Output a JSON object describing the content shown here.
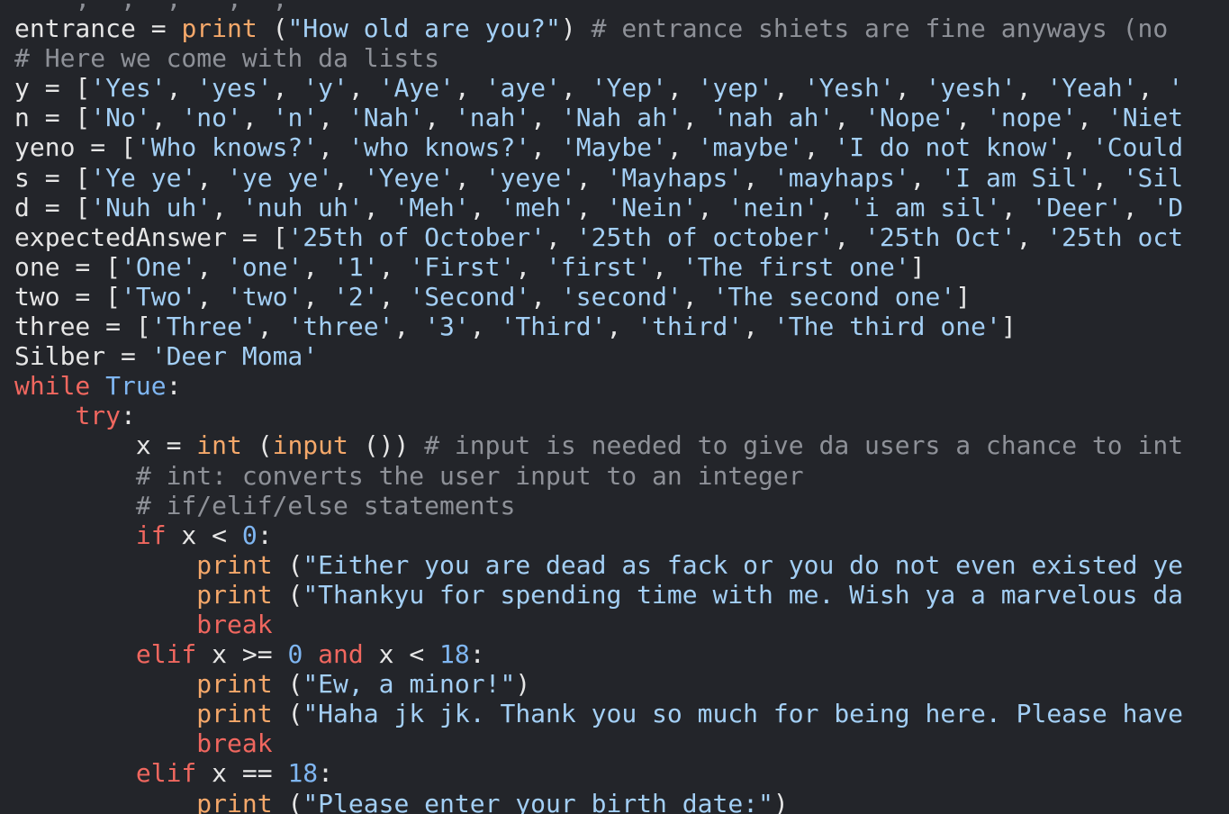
{
  "theme": {
    "background": "#23252a",
    "default": "#e6e6e6",
    "keyword": "#f0675f",
    "builtin": "#f5a86a",
    "string": "#a3cff5",
    "number": "#7fb6f2",
    "comment": "#8e9198"
  },
  "lines": [
    [
      [
        "comment",
        "    ,  ,  ,   ,  ,"
      ]
    ],
    [
      [
        "default",
        "entrance = "
      ],
      [
        "builtin",
        "print"
      ],
      [
        "default",
        " ("
      ],
      [
        "string",
        "\"How old are you?\""
      ],
      [
        "default",
        ") "
      ],
      [
        "comment",
        "# entrance shiets are fine anyways (no"
      ]
    ],
    [
      [
        "comment",
        "# Here we come with da lists"
      ]
    ],
    [
      [
        "default",
        "y = ["
      ],
      [
        "string",
        "'Yes'"
      ],
      [
        "default",
        ", "
      ],
      [
        "string",
        "'yes'"
      ],
      [
        "default",
        ", "
      ],
      [
        "string",
        "'y'"
      ],
      [
        "default",
        ", "
      ],
      [
        "string",
        "'Aye'"
      ],
      [
        "default",
        ", "
      ],
      [
        "string",
        "'aye'"
      ],
      [
        "default",
        ", "
      ],
      [
        "string",
        "'Yep'"
      ],
      [
        "default",
        ", "
      ],
      [
        "string",
        "'yep'"
      ],
      [
        "default",
        ", "
      ],
      [
        "string",
        "'Yesh'"
      ],
      [
        "default",
        ", "
      ],
      [
        "string",
        "'yesh'"
      ],
      [
        "default",
        ", "
      ],
      [
        "string",
        "'Yeah'"
      ],
      [
        "default",
        ", "
      ],
      [
        "string",
        "'"
      ]
    ],
    [
      [
        "default",
        "n = ["
      ],
      [
        "string",
        "'No'"
      ],
      [
        "default",
        ", "
      ],
      [
        "string",
        "'no'"
      ],
      [
        "default",
        ", "
      ],
      [
        "string",
        "'n'"
      ],
      [
        "default",
        ", "
      ],
      [
        "string",
        "'Nah'"
      ],
      [
        "default",
        ", "
      ],
      [
        "string",
        "'nah'"
      ],
      [
        "default",
        ", "
      ],
      [
        "string",
        "'Nah ah'"
      ],
      [
        "default",
        ", "
      ],
      [
        "string",
        "'nah ah'"
      ],
      [
        "default",
        ", "
      ],
      [
        "string",
        "'Nope'"
      ],
      [
        "default",
        ", "
      ],
      [
        "string",
        "'nope'"
      ],
      [
        "default",
        ", "
      ],
      [
        "string",
        "'Niet"
      ]
    ],
    [
      [
        "default",
        "yeno = ["
      ],
      [
        "string",
        "'Who knows?'"
      ],
      [
        "default",
        ", "
      ],
      [
        "string",
        "'who knows?'"
      ],
      [
        "default",
        ", "
      ],
      [
        "string",
        "'Maybe'"
      ],
      [
        "default",
        ", "
      ],
      [
        "string",
        "'maybe'"
      ],
      [
        "default",
        ", "
      ],
      [
        "string",
        "'I do not know'"
      ],
      [
        "default",
        ", "
      ],
      [
        "string",
        "'Could"
      ]
    ],
    [
      [
        "default",
        "s = ["
      ],
      [
        "string",
        "'Ye ye'"
      ],
      [
        "default",
        ", "
      ],
      [
        "string",
        "'ye ye'"
      ],
      [
        "default",
        ", "
      ],
      [
        "string",
        "'Yeye'"
      ],
      [
        "default",
        ", "
      ],
      [
        "string",
        "'yeye'"
      ],
      [
        "default",
        ", "
      ],
      [
        "string",
        "'Mayhaps'"
      ],
      [
        "default",
        ", "
      ],
      [
        "string",
        "'mayhaps'"
      ],
      [
        "default",
        ", "
      ],
      [
        "string",
        "'I am Sil'"
      ],
      [
        "default",
        ", "
      ],
      [
        "string",
        "'Sil"
      ]
    ],
    [
      [
        "default",
        "d = ["
      ],
      [
        "string",
        "'Nuh uh'"
      ],
      [
        "default",
        ", "
      ],
      [
        "string",
        "'nuh uh'"
      ],
      [
        "default",
        ", "
      ],
      [
        "string",
        "'Meh'"
      ],
      [
        "default",
        ", "
      ],
      [
        "string",
        "'meh'"
      ],
      [
        "default",
        ", "
      ],
      [
        "string",
        "'Nein'"
      ],
      [
        "default",
        ", "
      ],
      [
        "string",
        "'nein'"
      ],
      [
        "default",
        ", "
      ],
      [
        "string",
        "'i am sil'"
      ],
      [
        "default",
        ", "
      ],
      [
        "string",
        "'Deer'"
      ],
      [
        "default",
        ", "
      ],
      [
        "string",
        "'D"
      ]
    ],
    [
      [
        "default",
        "expectedAnswer = ["
      ],
      [
        "string",
        "'25th of October'"
      ],
      [
        "default",
        ", "
      ],
      [
        "string",
        "'25th of october'"
      ],
      [
        "default",
        ", "
      ],
      [
        "string",
        "'25th Oct'"
      ],
      [
        "default",
        ", "
      ],
      [
        "string",
        "'25th oct"
      ]
    ],
    [
      [
        "default",
        "one = ["
      ],
      [
        "string",
        "'One'"
      ],
      [
        "default",
        ", "
      ],
      [
        "string",
        "'one'"
      ],
      [
        "default",
        ", "
      ],
      [
        "string",
        "'1'"
      ],
      [
        "default",
        ", "
      ],
      [
        "string",
        "'First'"
      ],
      [
        "default",
        ", "
      ],
      [
        "string",
        "'first'"
      ],
      [
        "default",
        ", "
      ],
      [
        "string",
        "'The first one'"
      ],
      [
        "default",
        "]"
      ]
    ],
    [
      [
        "default",
        "two = ["
      ],
      [
        "string",
        "'Two'"
      ],
      [
        "default",
        ", "
      ],
      [
        "string",
        "'two'"
      ],
      [
        "default",
        ", "
      ],
      [
        "string",
        "'2'"
      ],
      [
        "default",
        ", "
      ],
      [
        "string",
        "'Second'"
      ],
      [
        "default",
        ", "
      ],
      [
        "string",
        "'second'"
      ],
      [
        "default",
        ", "
      ],
      [
        "string",
        "'The second one'"
      ],
      [
        "default",
        "]"
      ]
    ],
    [
      [
        "default",
        "three = ["
      ],
      [
        "string",
        "'Three'"
      ],
      [
        "default",
        ", "
      ],
      [
        "string",
        "'three'"
      ],
      [
        "default",
        ", "
      ],
      [
        "string",
        "'3'"
      ],
      [
        "default",
        ", "
      ],
      [
        "string",
        "'Third'"
      ],
      [
        "default",
        ", "
      ],
      [
        "string",
        "'third'"
      ],
      [
        "default",
        ", "
      ],
      [
        "string",
        "'The third one'"
      ],
      [
        "default",
        "]"
      ]
    ],
    [
      [
        "default",
        "Silber = "
      ],
      [
        "string",
        "'Deer Moma'"
      ]
    ],
    [
      [
        "keyword",
        "while"
      ],
      [
        "default",
        " "
      ],
      [
        "number",
        "True"
      ],
      [
        "default",
        ":"
      ]
    ],
    [
      [
        "default",
        "    "
      ],
      [
        "keyword",
        "try"
      ],
      [
        "default",
        ":"
      ]
    ],
    [
      [
        "default",
        "        x = "
      ],
      [
        "builtin",
        "int"
      ],
      [
        "default",
        " ("
      ],
      [
        "builtin",
        "input"
      ],
      [
        "default",
        " ()) "
      ],
      [
        "comment",
        "# input is needed to give da users a chance to int"
      ]
    ],
    [
      [
        "default",
        "        "
      ],
      [
        "comment",
        "# int: converts the user input to an integer"
      ]
    ],
    [
      [
        "default",
        "        "
      ],
      [
        "comment",
        "# if/elif/else statements"
      ]
    ],
    [
      [
        "default",
        "        "
      ],
      [
        "keyword",
        "if"
      ],
      [
        "default",
        " x < "
      ],
      [
        "number",
        "0"
      ],
      [
        "default",
        ":"
      ]
    ],
    [
      [
        "default",
        "            "
      ],
      [
        "builtin",
        "print"
      ],
      [
        "default",
        " ("
      ],
      [
        "string",
        "\"Either you are dead as fack or you do not even existed ye"
      ]
    ],
    [
      [
        "default",
        "            "
      ],
      [
        "builtin",
        "print"
      ],
      [
        "default",
        " ("
      ],
      [
        "string",
        "\"Thankyu for spending time with me. Wish ya a marvelous da"
      ]
    ],
    [
      [
        "default",
        "            "
      ],
      [
        "keyword",
        "break"
      ]
    ],
    [
      [
        "default",
        "        "
      ],
      [
        "keyword",
        "elif"
      ],
      [
        "default",
        " x >= "
      ],
      [
        "number",
        "0"
      ],
      [
        "default",
        " "
      ],
      [
        "keyword",
        "and"
      ],
      [
        "default",
        " x < "
      ],
      [
        "number",
        "18"
      ],
      [
        "default",
        ":"
      ]
    ],
    [
      [
        "default",
        "            "
      ],
      [
        "builtin",
        "print"
      ],
      [
        "default",
        " ("
      ],
      [
        "string",
        "\"Ew, a minor!\""
      ],
      [
        "default",
        ")"
      ]
    ],
    [
      [
        "default",
        "            "
      ],
      [
        "builtin",
        "print"
      ],
      [
        "default",
        " ("
      ],
      [
        "string",
        "\"Haha jk jk. Thank you so much for being here. Please have"
      ]
    ],
    [
      [
        "default",
        "            "
      ],
      [
        "keyword",
        "break"
      ]
    ],
    [
      [
        "default",
        "        "
      ],
      [
        "keyword",
        "elif"
      ],
      [
        "default",
        " x == "
      ],
      [
        "number",
        "18"
      ],
      [
        "default",
        ":"
      ]
    ],
    [
      [
        "default",
        "            "
      ],
      [
        "builtin",
        "print"
      ],
      [
        "default",
        " ("
      ],
      [
        "string",
        "\"Please enter your birth date:\""
      ],
      [
        "default",
        ")"
      ]
    ]
  ]
}
